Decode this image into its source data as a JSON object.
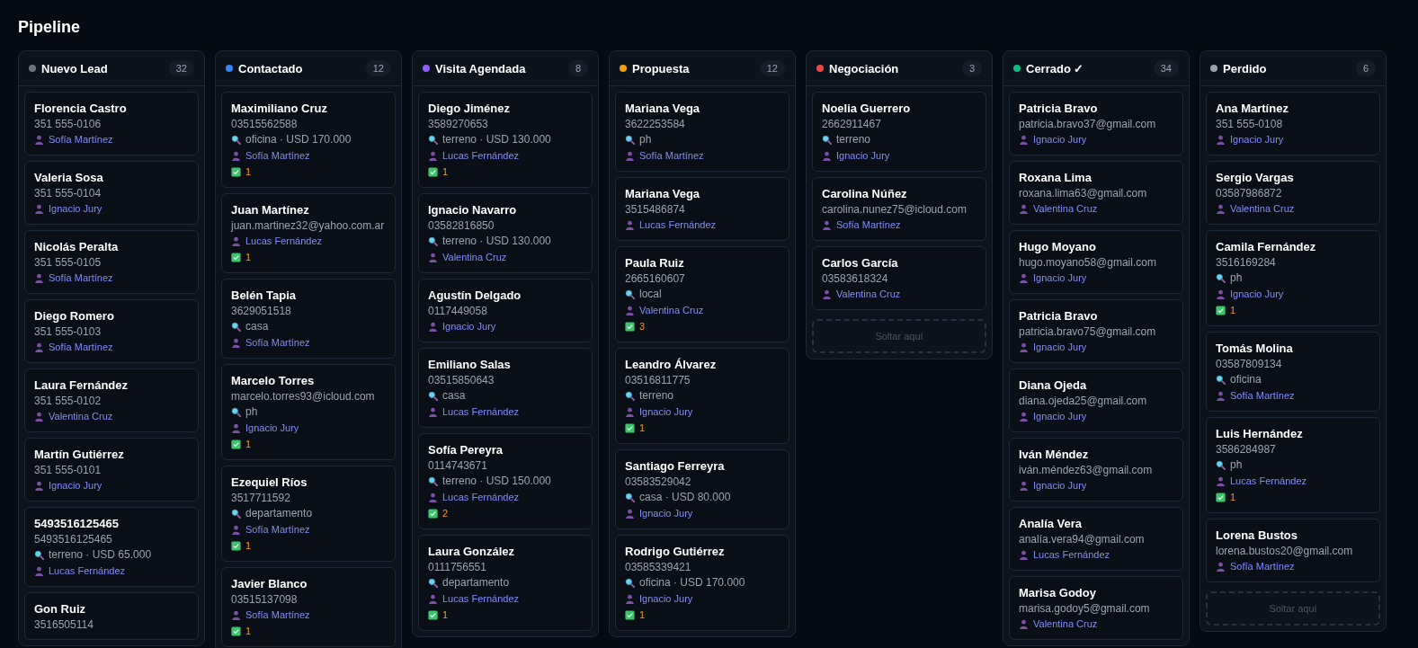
{
  "title": "Pipeline",
  "columns": [
    {
      "title": "Nuevo Lead",
      "color": "#6b7280",
      "count": "32",
      "cards": [
        {
          "name": "Florencia Castro",
          "contact": "351 555-0106",
          "agent": "Sofía Martínez"
        },
        {
          "name": "Valeria Sosa",
          "contact": "351 555-0104",
          "agent": "Ignacio Jury"
        },
        {
          "name": "Nicolás Peralta",
          "contact": "351 555-0105",
          "agent": "Sofía Martínez"
        },
        {
          "name": "Diego Romero",
          "contact": "351 555-0103",
          "agent": "Sofía Martínez"
        },
        {
          "name": "Laura Fernández",
          "contact": "351 555-0102",
          "agent": "Valentina Cruz"
        },
        {
          "name": "Martín Gutiérrez",
          "contact": "351 555-0101",
          "agent": "Ignacio Jury"
        },
        {
          "name": "5493516125465",
          "contact": "5493516125465",
          "search": "terreno · USD 65.000",
          "agent": "Lucas Fernández"
        },
        {
          "name": "Gon Ruiz",
          "contact": "3516505114"
        }
      ]
    },
    {
      "title": "Contactado",
      "color": "#3b82f6",
      "count": "12",
      "cards": [
        {
          "name": "Maximiliano Cruz",
          "contact": "03515562588",
          "search": "oficina · USD 170.000",
          "agent": "Sofía Martínez",
          "tasks": "1"
        },
        {
          "name": "Juan Martínez",
          "contact": "juan.martinez32@yahoo.com.ar",
          "agent": "Lucas Fernández",
          "tasks": "1"
        },
        {
          "name": "Belén Tapia",
          "contact": "3629051518",
          "search": "casa",
          "agent": "Sofía Martínez"
        },
        {
          "name": "Marcelo Torres",
          "contact": "marcelo.torres93@icloud.com",
          "search": "ph",
          "agent": "Ignacio Jury",
          "tasks": "1"
        },
        {
          "name": "Ezequiel Ríos",
          "contact": "3517711592",
          "search": "departamento",
          "agent": "Sofía Martínez",
          "tasks": "1"
        },
        {
          "name": "Javier Blanco",
          "contact": "03515137098",
          "agent": "Sofía Martínez",
          "tasks": "1"
        }
      ]
    },
    {
      "title": "Visita Agendada",
      "color": "#8b5cf6",
      "count": "8",
      "cards": [
        {
          "name": "Diego Jiménez",
          "contact": "3589270653",
          "search": "terreno · USD 130.000",
          "agent": "Lucas Fernández",
          "tasks": "1"
        },
        {
          "name": "Ignacio Navarro",
          "contact": "03582816850",
          "search": "terreno · USD 130.000",
          "agent": "Valentina Cruz"
        },
        {
          "name": "Agustín Delgado",
          "contact": "0117449058",
          "agent": "Ignacio Jury"
        },
        {
          "name": "Emiliano Salas",
          "contact": "03515850643",
          "search": "casa",
          "agent": "Lucas Fernández"
        },
        {
          "name": "Sofía Pereyra",
          "contact": "0114743671",
          "search": "terreno · USD 150.000",
          "agent": "Lucas Fernández",
          "tasks": "2"
        },
        {
          "name": "Laura González",
          "contact": "0111756551",
          "search": "departamento",
          "agent": "Lucas Fernández",
          "tasks": "1"
        }
      ]
    },
    {
      "title": "Propuesta",
      "color": "#f59e0b",
      "count": "12",
      "cards": [
        {
          "name": "Mariana Vega",
          "contact": "3622253584",
          "search": "ph",
          "agent": "Sofía Martínez"
        },
        {
          "name": "Mariana Vega",
          "contact": "3515486874",
          "agent": "Lucas Fernández"
        },
        {
          "name": "Paula Ruiz",
          "contact": "2665160607",
          "search": "local",
          "agent": "Valentina Cruz",
          "tasks": "3"
        },
        {
          "name": "Leandro Álvarez",
          "contact": "03516811775",
          "search": "terreno",
          "agent": "Ignacio Jury",
          "tasks": "1"
        },
        {
          "name": "Santiago Ferreyra",
          "contact": "03583529042",
          "search": "casa · USD 80.000",
          "agent": "Ignacio Jury"
        },
        {
          "name": "Rodrigo Gutiérrez",
          "contact": "03585339421",
          "search": "oficina · USD 170.000",
          "agent": "Ignacio Jury",
          "tasks": "1"
        }
      ]
    },
    {
      "title": "Negociación",
      "color": "#ef4444",
      "count": "3",
      "drop_zone": "Soltar aquí",
      "cards": [
        {
          "name": "Noelia Guerrero",
          "contact": "2662911467",
          "search": "terreno",
          "agent": "Ignacio Jury"
        },
        {
          "name": "Carolina Núñez",
          "contact": "carolina.nunez75@icloud.com",
          "agent": "Sofía Martínez"
        },
        {
          "name": "Carlos García",
          "contact": "03583618324",
          "agent": "Valentina Cruz"
        }
      ]
    },
    {
      "title": "Cerrado ✓",
      "color": "#10b981",
      "count": "34",
      "cards": [
        {
          "name": "Patricia Bravo",
          "contact": "patricia.bravo37@gmail.com",
          "agent": "Ignacio Jury"
        },
        {
          "name": "Roxana Lima",
          "contact": "roxana.lima63@gmail.com",
          "agent": "Valentina Cruz"
        },
        {
          "name": "Hugo Moyano",
          "contact": "hugo.moyano58@gmail.com",
          "agent": "Ignacio Jury"
        },
        {
          "name": "Patricia Bravo",
          "contact": "patricia.bravo75@gmail.com",
          "agent": "Ignacio Jury"
        },
        {
          "name": "Diana Ojeda",
          "contact": "diana.ojeda25@gmail.com",
          "agent": "Ignacio Jury"
        },
        {
          "name": "Iván Méndez",
          "contact": "iván.méndez63@gmail.com",
          "agent": "Ignacio Jury"
        },
        {
          "name": "Analía Vera",
          "contact": "analía.vera94@gmail.com",
          "agent": "Lucas Fernández"
        },
        {
          "name": "Marisa Godoy",
          "contact": "marisa.godoy5@gmail.com",
          "agent": "Valentina Cruz"
        }
      ]
    },
    {
      "title": "Perdido",
      "color": "#9ca3af",
      "count": "6",
      "drop_zone": "Soltar aquí",
      "cards": [
        {
          "name": "Ana Martínez",
          "contact": "351 555-0108",
          "agent": "Ignacio Jury"
        },
        {
          "name": "Sergio Vargas",
          "contact": "03587986872",
          "agent": "Valentina Cruz"
        },
        {
          "name": "Camila Fernández",
          "contact": "3516169284",
          "search": "ph",
          "agent": "Ignacio Jury",
          "tasks": "1"
        },
        {
          "name": "Tomás Molina",
          "contact": "03587809134",
          "search": "oficina",
          "agent": "Sofía Martínez"
        },
        {
          "name": "Luis Hernández",
          "contact": "3586284987",
          "search": "ph",
          "agent": "Lucas Fernández",
          "tasks": "1"
        },
        {
          "name": "Lorena Bustos",
          "contact": "lorena.bustos20@gmail.com",
          "agent": "Sofía Martínez"
        }
      ]
    }
  ]
}
